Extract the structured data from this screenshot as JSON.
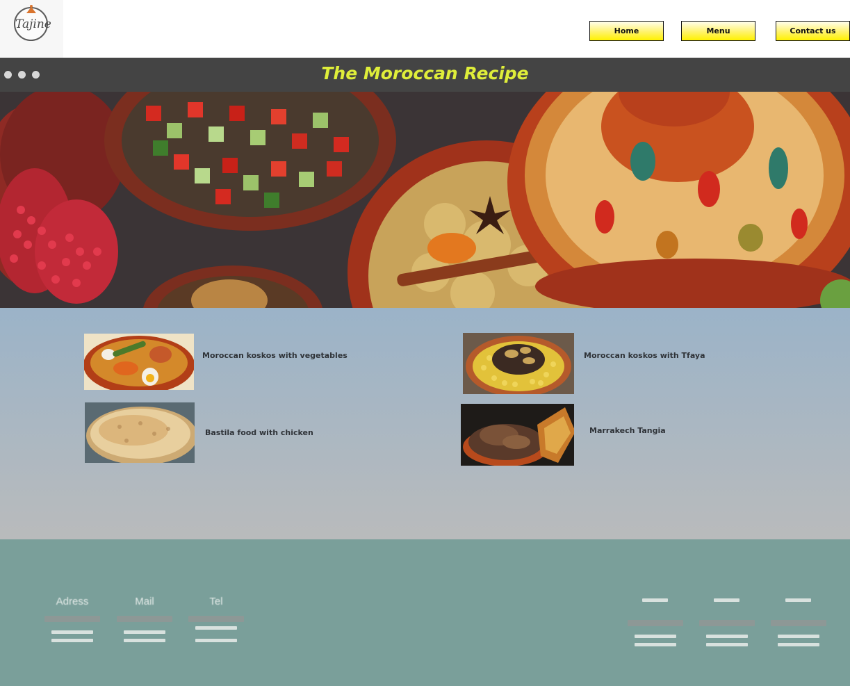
{
  "header": {
    "logo_text": "Tajine",
    "nav": {
      "home": "Home",
      "menu": "Menu",
      "contact": "Contact us"
    }
  },
  "titlebar": {
    "title": "The Moroccan Recipe"
  },
  "dishes": [
    {
      "label": "Moroccan koskos with vegetables"
    },
    {
      "label": "Moroccan koskos with  Tfaya"
    },
    {
      "label": "Bastila food with chicken"
    },
    {
      "label": "Marrakech Tangia"
    }
  ],
  "footer": {
    "columns": [
      {
        "label": "Adress"
      },
      {
        "label": "Mail"
      },
      {
        "label": "Tel"
      }
    ]
  },
  "colors": {
    "accent_yellow": "#fff200",
    "title_color": "#dfee3a",
    "titlebar_bg": "#444444",
    "footer_bg": "#7a9f9a"
  }
}
